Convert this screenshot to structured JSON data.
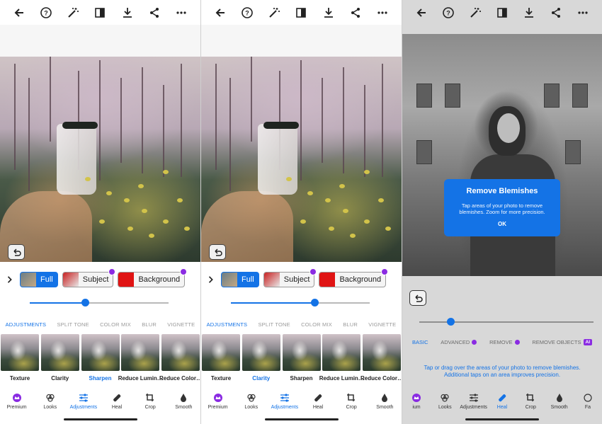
{
  "topbar": {
    "icons": [
      "back-arrow-icon",
      "help-icon",
      "magic-wand-icon",
      "compare-icon",
      "download-icon",
      "share-icon",
      "more-icon"
    ]
  },
  "panel1": {
    "mask_chips": [
      {
        "label": "Full",
        "active": true,
        "premium": false
      },
      {
        "label": "Subject",
        "active": false,
        "premium": true
      },
      {
        "label": "Background",
        "active": false,
        "premium": true
      }
    ],
    "slider_value": 0.4,
    "categories": [
      {
        "label": "ADJUSTMENTS",
        "active": true
      },
      {
        "label": "SPLIT TONE",
        "active": false
      },
      {
        "label": "COLOR MIX",
        "active": false
      },
      {
        "label": "BLUR",
        "active": false
      },
      {
        "label": "VIGNETTE",
        "active": false
      }
    ],
    "tools": [
      {
        "label": "Texture",
        "active": false
      },
      {
        "label": "Clarity",
        "active": false
      },
      {
        "label": "Sharpen",
        "active": true
      },
      {
        "label": "Reduce Lumin…",
        "active": false
      },
      {
        "label": "Reduce Color…",
        "active": false
      }
    ],
    "nav": [
      {
        "label": "Premium",
        "icon": "crown-icon",
        "active": false
      },
      {
        "label": "Looks",
        "icon": "looks-icon",
        "active": false
      },
      {
        "label": "Adjustments",
        "icon": "sliders-icon",
        "active": true
      },
      {
        "label": "Heal",
        "icon": "bandage-icon",
        "active": false
      },
      {
        "label": "Crop",
        "icon": "crop-icon",
        "active": false
      },
      {
        "label": "Smooth",
        "icon": "drop-icon",
        "active": false
      }
    ]
  },
  "panel2": {
    "mask_chips": [
      {
        "label": "Full",
        "active": true,
        "premium": false
      },
      {
        "label": "Subject",
        "active": false,
        "premium": true
      },
      {
        "label": "Background",
        "active": false,
        "premium": true
      }
    ],
    "slider_value": 0.6,
    "categories": [
      {
        "label": "ADJUSTMENTS",
        "active": true
      },
      {
        "label": "SPLIT TONE",
        "active": false
      },
      {
        "label": "COLOR MIX",
        "active": false
      },
      {
        "label": "BLUR",
        "active": false
      },
      {
        "label": "VIGNETTE",
        "active": false
      }
    ],
    "tools": [
      {
        "label": "Texture",
        "active": false
      },
      {
        "label": "Clarity",
        "active": true
      },
      {
        "label": "Sharpen",
        "active": false
      },
      {
        "label": "Reduce Lumin…",
        "active": false
      },
      {
        "label": "Reduce Color…",
        "active": false
      }
    ],
    "nav": [
      {
        "label": "Premium",
        "icon": "crown-icon",
        "active": false
      },
      {
        "label": "Looks",
        "icon": "looks-icon",
        "active": false
      },
      {
        "label": "Adjustments",
        "icon": "sliders-icon",
        "active": true
      },
      {
        "label": "Heal",
        "icon": "bandage-icon",
        "active": false
      },
      {
        "label": "Crop",
        "icon": "crop-icon",
        "active": false
      },
      {
        "label": "Smooth",
        "icon": "drop-icon",
        "active": false
      }
    ]
  },
  "panel3": {
    "dialog": {
      "title": "Remove Blemishes",
      "body": "Tap areas of your photo to remove blemishes. Zoom for more precision.",
      "ok": "OK"
    },
    "slider_value": 0.18,
    "tabs": [
      {
        "label": "BASIC",
        "active": true,
        "badge": ""
      },
      {
        "label": "ADVANCED",
        "active": false,
        "badge": "dot"
      },
      {
        "label": "REMOVE",
        "active": false,
        "badge": "dot"
      },
      {
        "label": "REMOVE OBJECTS",
        "active": false,
        "badge": "AI"
      }
    ],
    "hint": "Tap or drag over the areas of your photo to remove blemishes. Additional taps on an area improves precision.",
    "nav": [
      {
        "label": "ium",
        "icon": "crown-icon",
        "active": false
      },
      {
        "label": "Looks",
        "icon": "looks-icon",
        "active": false
      },
      {
        "label": "Adjustments",
        "icon": "sliders-icon",
        "active": false
      },
      {
        "label": "Heal",
        "icon": "bandage-icon",
        "active": true
      },
      {
        "label": "Crop",
        "icon": "crop-icon",
        "active": false
      },
      {
        "label": "Smooth",
        "icon": "drop-icon",
        "active": false
      },
      {
        "label": "Fa",
        "icon": "face-icon",
        "active": false
      }
    ]
  },
  "colors": {
    "accent": "#1473e6",
    "premium": "#8a2be2"
  }
}
